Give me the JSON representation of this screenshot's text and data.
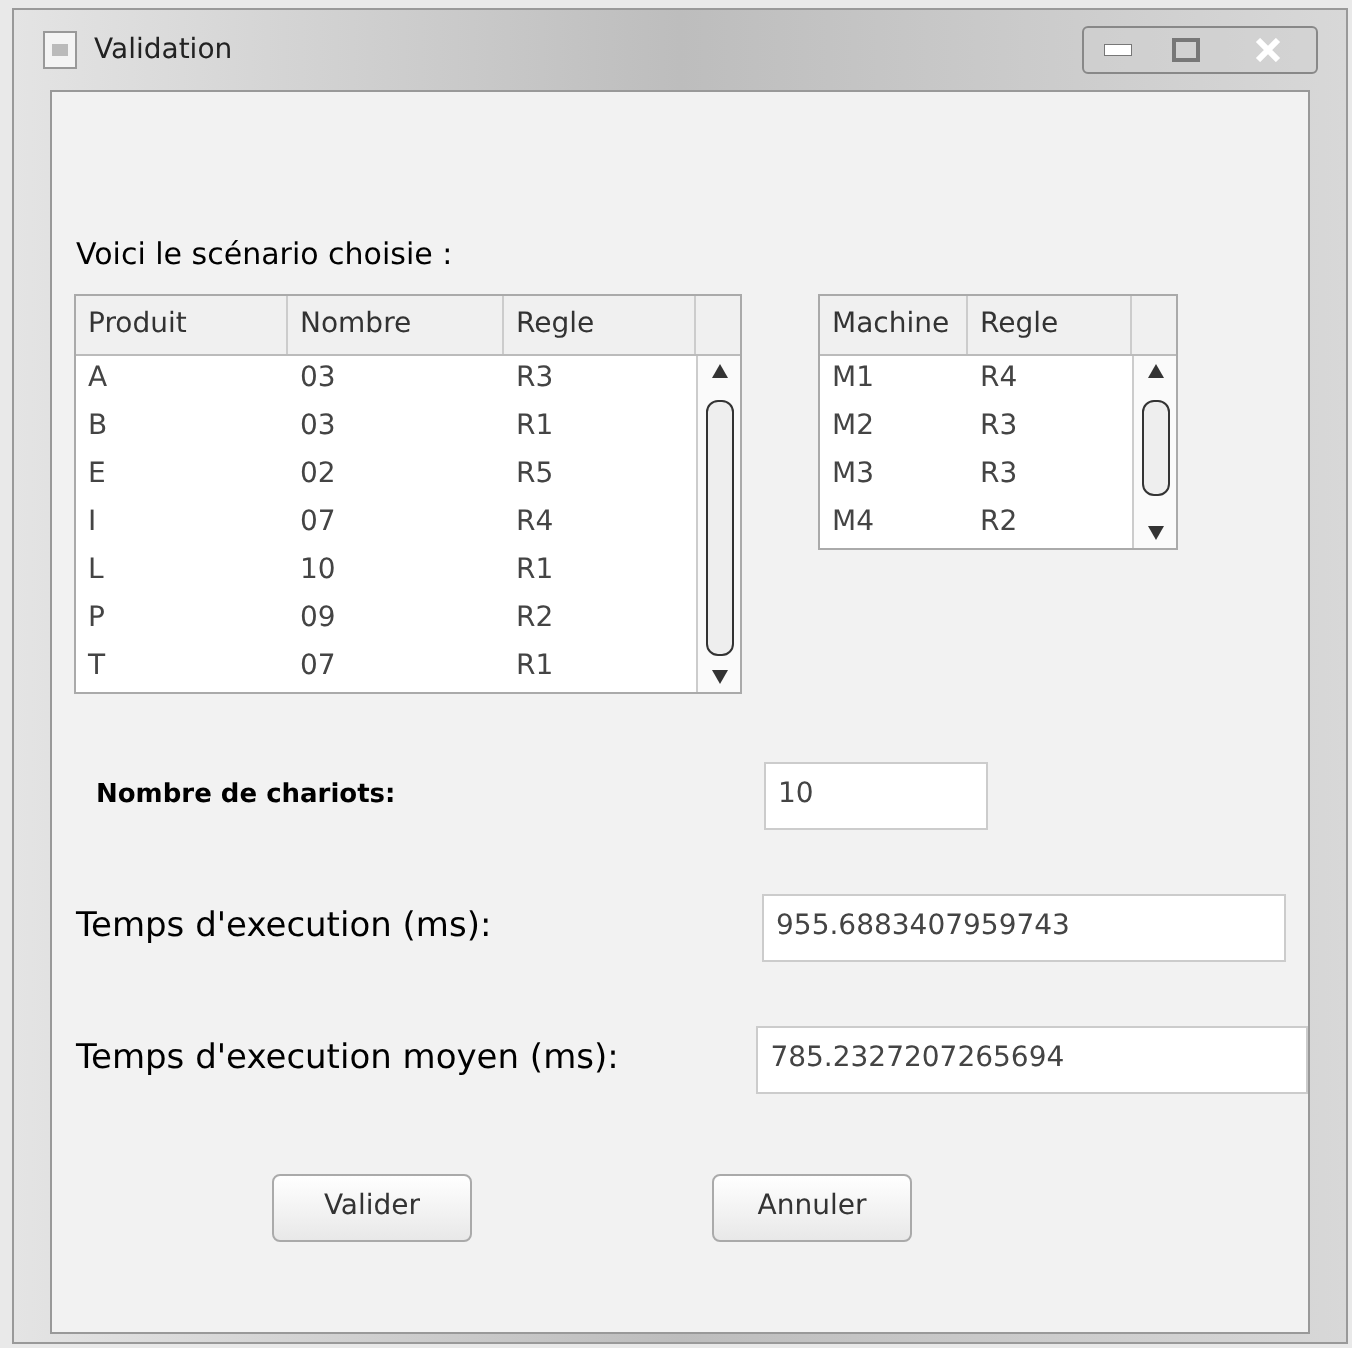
{
  "window": {
    "title": "Validation"
  },
  "heading": "Voici le scénario choisie :",
  "products_table": {
    "columns": [
      "Produit",
      "Nombre",
      "Regle"
    ],
    "rows": [
      [
        "A",
        "03",
        "R3"
      ],
      [
        "B",
        "03",
        "R1"
      ],
      [
        "E",
        "02",
        "R5"
      ],
      [
        "I",
        "07",
        "R4"
      ],
      [
        "L",
        "10",
        "R1"
      ],
      [
        "P",
        "09",
        "R2"
      ],
      [
        "T",
        "07",
        "R1"
      ]
    ]
  },
  "machines_table": {
    "columns": [
      "Machine",
      "Regle"
    ],
    "rows": [
      [
        "M1",
        "R4"
      ],
      [
        "M2",
        "R3"
      ],
      [
        "M3",
        "R3"
      ],
      [
        "M4",
        "R2"
      ]
    ]
  },
  "fields": [
    {
      "label": "Nombre de chariots:",
      "value": "10",
      "kind": "small"
    },
    {
      "label": "Temps d'execution (ms):",
      "value": "955.6883407959743",
      "kind": "large"
    },
    {
      "label": "Temps d'execution moyen (ms):",
      "value": "785.2327207265694",
      "kind": "large"
    }
  ],
  "buttons": [
    "Valider",
    "Annuler"
  ]
}
